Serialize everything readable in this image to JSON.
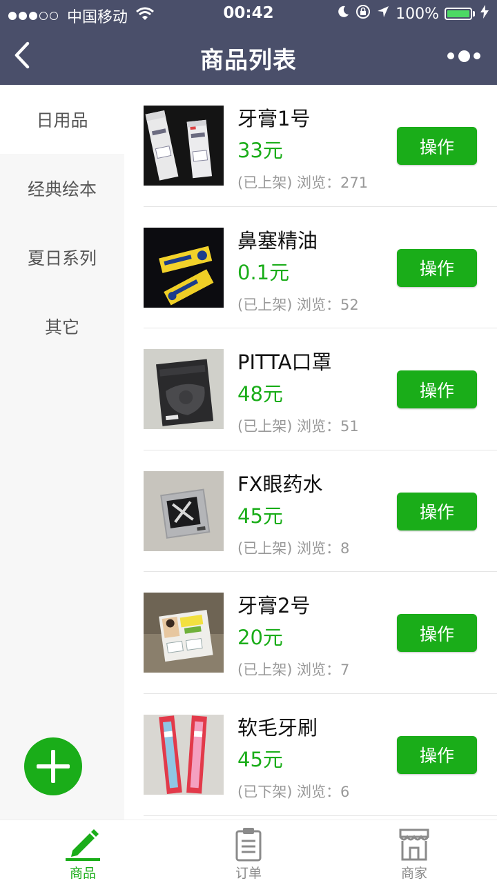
{
  "status_bar": {
    "carrier": "中国移动",
    "time": "00:42",
    "battery": "100%"
  },
  "nav": {
    "title": "商品列表",
    "back_icon": "chevron-left-icon",
    "more_icon": "more-dots-icon"
  },
  "sidebar": {
    "categories": [
      "日用品",
      "经典绘本",
      "夏日系列",
      "其它"
    ],
    "active_index": 0,
    "add_icon": "plus-icon"
  },
  "products": [
    {
      "name": "牙膏1号",
      "price": "33元",
      "meta": "(已上架) 浏览：271",
      "action": "操作"
    },
    {
      "name": "鼻塞精油",
      "price": "0.1元",
      "meta": "(已上架) 浏览：52",
      "action": "操作"
    },
    {
      "name": "PITTA口罩",
      "price": "48元",
      "meta": "(已上架) 浏览：51",
      "action": "操作"
    },
    {
      "name": "FX眼药水",
      "price": "45元",
      "meta": "(已上架) 浏览：8",
      "action": "操作"
    },
    {
      "name": "牙膏2号",
      "price": "20元",
      "meta": "(已上架) 浏览：7",
      "action": "操作"
    },
    {
      "name": "软毛牙刷",
      "price": "45元",
      "meta": "(已下架) 浏览：6",
      "action": "操作"
    }
  ],
  "tabs": [
    {
      "label": "商品",
      "icon": "pencil-icon",
      "active": true
    },
    {
      "label": "订单",
      "icon": "clipboard-icon",
      "active": false
    },
    {
      "label": "商家",
      "icon": "store-icon",
      "active": false
    }
  ],
  "colors": {
    "header": "#4a4f6a",
    "accent": "#1aad19",
    "sidebar_bg": "#f7f7f7",
    "muted_text": "#999999"
  }
}
